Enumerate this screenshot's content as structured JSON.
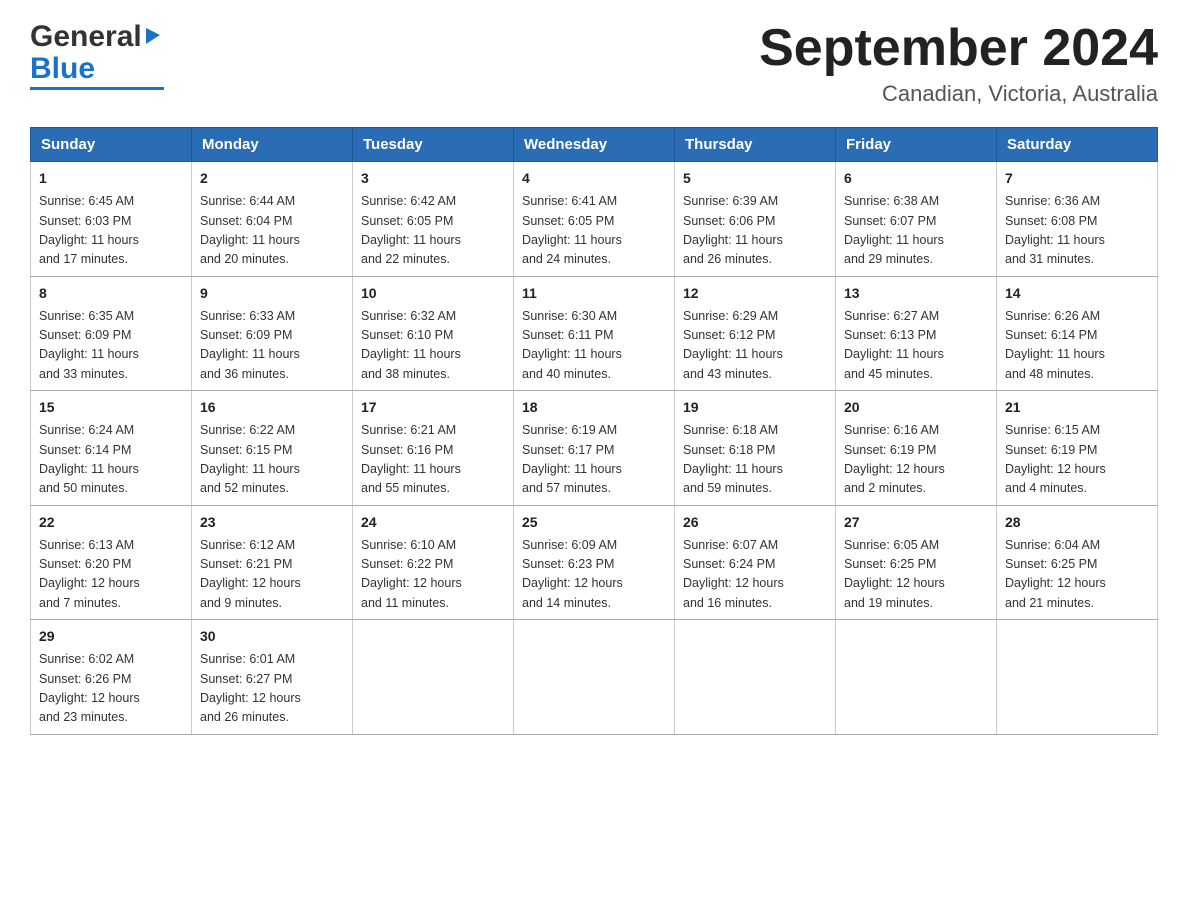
{
  "logo": {
    "general": "General",
    "blue": "Blue"
  },
  "header": {
    "month": "September 2024",
    "location": "Canadian, Victoria, Australia"
  },
  "weekdays": [
    "Sunday",
    "Monday",
    "Tuesday",
    "Wednesday",
    "Thursday",
    "Friday",
    "Saturday"
  ],
  "weeks": [
    [
      {
        "day": "1",
        "sunrise": "6:45 AM",
        "sunset": "6:03 PM",
        "daylight": "11 hours and 17 minutes."
      },
      {
        "day": "2",
        "sunrise": "6:44 AM",
        "sunset": "6:04 PM",
        "daylight": "11 hours and 20 minutes."
      },
      {
        "day": "3",
        "sunrise": "6:42 AM",
        "sunset": "6:05 PM",
        "daylight": "11 hours and 22 minutes."
      },
      {
        "day": "4",
        "sunrise": "6:41 AM",
        "sunset": "6:05 PM",
        "daylight": "11 hours and 24 minutes."
      },
      {
        "day": "5",
        "sunrise": "6:39 AM",
        "sunset": "6:06 PM",
        "daylight": "11 hours and 26 minutes."
      },
      {
        "day": "6",
        "sunrise": "6:38 AM",
        "sunset": "6:07 PM",
        "daylight": "11 hours and 29 minutes."
      },
      {
        "day": "7",
        "sunrise": "6:36 AM",
        "sunset": "6:08 PM",
        "daylight": "11 hours and 31 minutes."
      }
    ],
    [
      {
        "day": "8",
        "sunrise": "6:35 AM",
        "sunset": "6:09 PM",
        "daylight": "11 hours and 33 minutes."
      },
      {
        "day": "9",
        "sunrise": "6:33 AM",
        "sunset": "6:09 PM",
        "daylight": "11 hours and 36 minutes."
      },
      {
        "day": "10",
        "sunrise": "6:32 AM",
        "sunset": "6:10 PM",
        "daylight": "11 hours and 38 minutes."
      },
      {
        "day": "11",
        "sunrise": "6:30 AM",
        "sunset": "6:11 PM",
        "daylight": "11 hours and 40 minutes."
      },
      {
        "day": "12",
        "sunrise": "6:29 AM",
        "sunset": "6:12 PM",
        "daylight": "11 hours and 43 minutes."
      },
      {
        "day": "13",
        "sunrise": "6:27 AM",
        "sunset": "6:13 PM",
        "daylight": "11 hours and 45 minutes."
      },
      {
        "day": "14",
        "sunrise": "6:26 AM",
        "sunset": "6:14 PM",
        "daylight": "11 hours and 48 minutes."
      }
    ],
    [
      {
        "day": "15",
        "sunrise": "6:24 AM",
        "sunset": "6:14 PM",
        "daylight": "11 hours and 50 minutes."
      },
      {
        "day": "16",
        "sunrise": "6:22 AM",
        "sunset": "6:15 PM",
        "daylight": "11 hours and 52 minutes."
      },
      {
        "day": "17",
        "sunrise": "6:21 AM",
        "sunset": "6:16 PM",
        "daylight": "11 hours and 55 minutes."
      },
      {
        "day": "18",
        "sunrise": "6:19 AM",
        "sunset": "6:17 PM",
        "daylight": "11 hours and 57 minutes."
      },
      {
        "day": "19",
        "sunrise": "6:18 AM",
        "sunset": "6:18 PM",
        "daylight": "11 hours and 59 minutes."
      },
      {
        "day": "20",
        "sunrise": "6:16 AM",
        "sunset": "6:19 PM",
        "daylight": "12 hours and 2 minutes."
      },
      {
        "day": "21",
        "sunrise": "6:15 AM",
        "sunset": "6:19 PM",
        "daylight": "12 hours and 4 minutes."
      }
    ],
    [
      {
        "day": "22",
        "sunrise": "6:13 AM",
        "sunset": "6:20 PM",
        "daylight": "12 hours and 7 minutes."
      },
      {
        "day": "23",
        "sunrise": "6:12 AM",
        "sunset": "6:21 PM",
        "daylight": "12 hours and 9 minutes."
      },
      {
        "day": "24",
        "sunrise": "6:10 AM",
        "sunset": "6:22 PM",
        "daylight": "12 hours and 11 minutes."
      },
      {
        "day": "25",
        "sunrise": "6:09 AM",
        "sunset": "6:23 PM",
        "daylight": "12 hours and 14 minutes."
      },
      {
        "day": "26",
        "sunrise": "6:07 AM",
        "sunset": "6:24 PM",
        "daylight": "12 hours and 16 minutes."
      },
      {
        "day": "27",
        "sunrise": "6:05 AM",
        "sunset": "6:25 PM",
        "daylight": "12 hours and 19 minutes."
      },
      {
        "day": "28",
        "sunrise": "6:04 AM",
        "sunset": "6:25 PM",
        "daylight": "12 hours and 21 minutes."
      }
    ],
    [
      {
        "day": "29",
        "sunrise": "6:02 AM",
        "sunset": "6:26 PM",
        "daylight": "12 hours and 23 minutes."
      },
      {
        "day": "30",
        "sunrise": "6:01 AM",
        "sunset": "6:27 PM",
        "daylight": "12 hours and 26 minutes."
      },
      null,
      null,
      null,
      null,
      null
    ]
  ],
  "labels": {
    "sunrise": "Sunrise:",
    "sunset": "Sunset:",
    "daylight": "Daylight:"
  }
}
